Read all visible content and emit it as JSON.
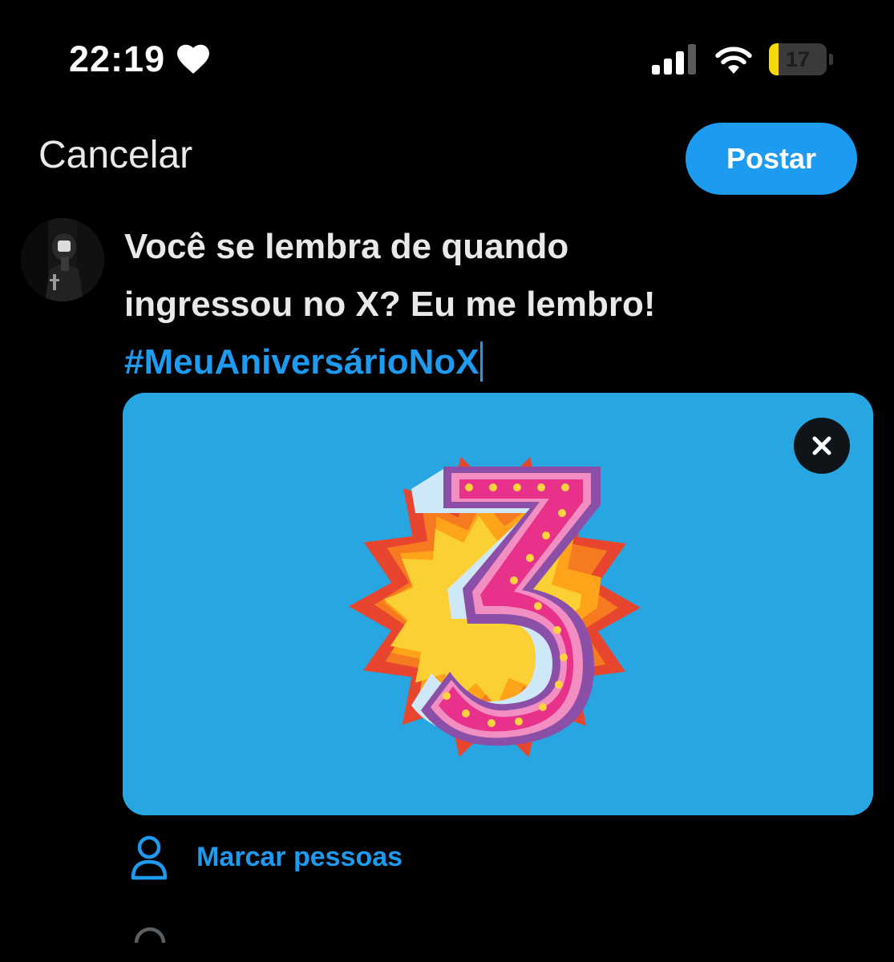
{
  "status_bar": {
    "time": "22:19",
    "heart_icon": "heart-icon",
    "signal_icon": "cellular-signal-icon",
    "wifi_icon": "wifi-icon",
    "battery_level": "17",
    "battery_fraction": 0.17,
    "battery_color": "#f5d90a"
  },
  "header": {
    "cancel_label": "Cancelar",
    "post_label": "Postar"
  },
  "composer": {
    "line1": "Você se lembra de quando",
    "line2": "ingressou no X? Eu me lembro!",
    "hashtag": "#MeuAniversárioNoX"
  },
  "media": {
    "close_icon": "close-icon"
  },
  "actions": {
    "tag_people_label": "Marcar pessoas"
  },
  "colors": {
    "accent": "#1d9bf0",
    "background": "#000000",
    "text": "#e7e9ea",
    "media_background": "#27a6e2"
  }
}
